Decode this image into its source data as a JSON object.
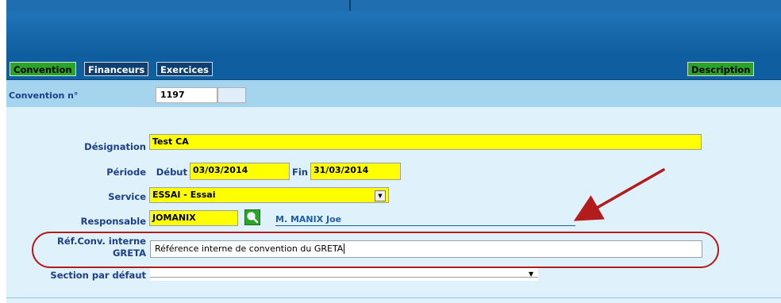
{
  "tabs": {
    "convention": "Convention",
    "financeurs": "Financeurs",
    "exercices": "Exercices",
    "description": "Description"
  },
  "header": {
    "convention_label": "Convention n°",
    "convention_number": "1197"
  },
  "form": {
    "designation_label": "Désignation",
    "designation_value": "Test CA",
    "periode_label": "Période",
    "debut_label": "Début",
    "debut_value": "03/03/2014",
    "fin_label": "Fin",
    "fin_value": "31/03/2014",
    "service_label": "Service",
    "service_value": "ESSAI - Essai",
    "responsable_label": "Responsable",
    "responsable_code": "JOMANIX",
    "responsable_name": "M. MANIX Joe",
    "ref_label_line1": "Réf.Conv. interne",
    "ref_label_line2": "GRETA",
    "ref_value": "Référence interne de convention du GRETA",
    "section_label": "Section par défaut",
    "section_value": ""
  },
  "icons": {
    "search": "search-icon",
    "dropdown": "chevron-down-icon"
  },
  "colors": {
    "accent_blue": "#0f5fa0",
    "tab_green": "#2aa52a",
    "field_yellow": "#ffff00",
    "annotation_red": "#b31c1c"
  }
}
